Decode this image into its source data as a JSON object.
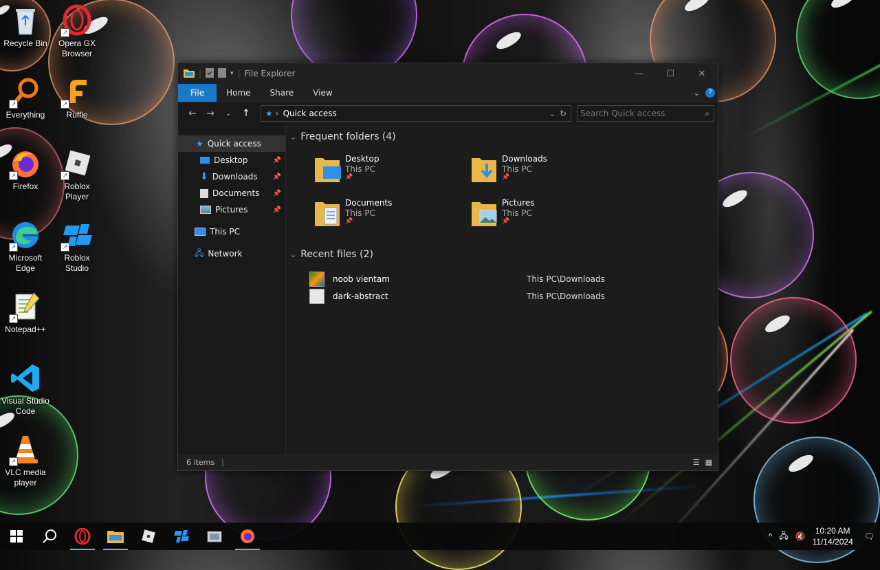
{
  "desktop": {
    "icons": [
      {
        "label": "Recycle Bin"
      },
      {
        "label": "Opera GX Browser"
      },
      {
        "label": "Everything"
      },
      {
        "label": "Ruffle"
      },
      {
        "label": "Firefox"
      },
      {
        "label": "Roblox Player"
      },
      {
        "label": "Microsoft Edge"
      },
      {
        "label": "Roblox Studio"
      },
      {
        "label": "Notepad++"
      },
      {
        "label": "Visual Studio Code"
      },
      {
        "label": "VLC media player"
      }
    ]
  },
  "explorer": {
    "title": "File Explorer",
    "ribbon_tabs": [
      "File",
      "Home",
      "Share",
      "View"
    ],
    "address": "Quick access",
    "search_placeholder": "Search Quick access",
    "nav": {
      "quick_access": "Quick access",
      "pinned": [
        "Desktop",
        "Downloads",
        "Documents",
        "Pictures"
      ],
      "this_pc": "This PC",
      "network": "Network"
    },
    "frequent_header": "Frequent folders (4)",
    "frequent": [
      {
        "name": "Desktop",
        "location": "This PC"
      },
      {
        "name": "Downloads",
        "location": "This PC"
      },
      {
        "name": "Documents",
        "location": "This PC"
      },
      {
        "name": "Pictures",
        "location": "This PC"
      }
    ],
    "recent_header": "Recent files (2)",
    "recent": [
      {
        "name": "noob vientam",
        "location": "This PC\\Downloads"
      },
      {
        "name": "dark-abstract",
        "location": "This PC\\Downloads"
      }
    ],
    "status": "6 items"
  },
  "taskbar": {
    "time": "10:20 AM",
    "date": "11/14/2024"
  },
  "colors": {
    "accent": "#1979ca",
    "explorer_bg": "#191919"
  }
}
